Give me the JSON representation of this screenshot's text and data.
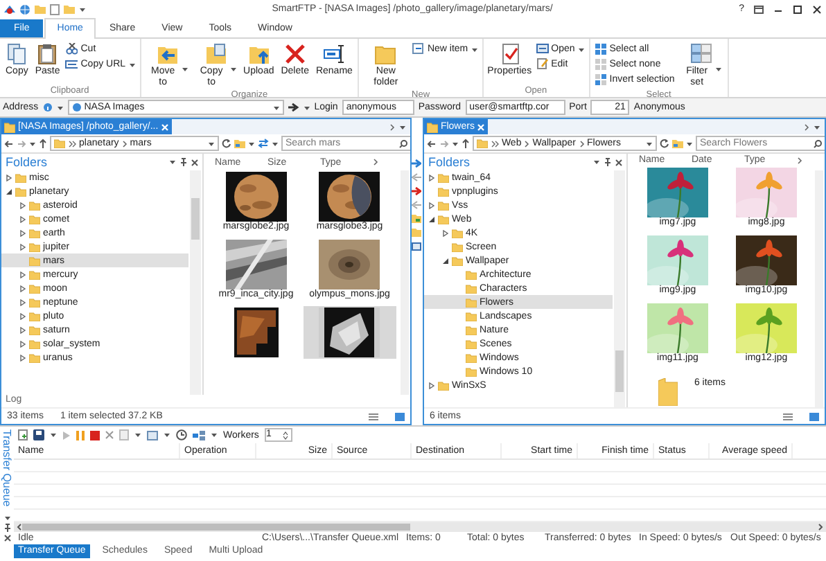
{
  "window": {
    "title": "SmartFTP - [NASA Images] /photo_gallery/image/planetary/mars/",
    "help": "?"
  },
  "ribbon_tabs": [
    {
      "label": "File",
      "kind": "file",
      "selected": false
    },
    {
      "label": "Home",
      "kind": "tab",
      "selected": true
    },
    {
      "label": "Share",
      "kind": "tab",
      "selected": false
    },
    {
      "label": "View",
      "kind": "tab",
      "selected": false
    },
    {
      "label": "Tools",
      "kind": "tab",
      "selected": false
    },
    {
      "label": "Window",
      "kind": "tab",
      "selected": false
    }
  ],
  "ribbon": {
    "groups": [
      {
        "label": "Clipboard",
        "items": [
          {
            "label": "Copy",
            "kind": "large"
          },
          {
            "label": "Paste",
            "kind": "large"
          },
          {
            "label": "Cut",
            "kind": "small"
          },
          {
            "label": "Copy URL",
            "kind": "small",
            "dropdown": true
          }
        ]
      },
      {
        "label": "Organize",
        "items": [
          {
            "label": "Move to",
            "kind": "large",
            "dropdown": true
          },
          {
            "label": "Copy to",
            "kind": "large",
            "dropdown": true
          },
          {
            "label": "Upload",
            "kind": "large"
          },
          {
            "label": "Delete",
            "kind": "large"
          },
          {
            "label": "Rename",
            "kind": "large"
          }
        ]
      },
      {
        "label": "New",
        "items": [
          {
            "label": "New folder",
            "kind": "large"
          },
          {
            "label": "New item",
            "kind": "small",
            "dropdown": true
          }
        ]
      },
      {
        "label": "Open",
        "items": [
          {
            "label": "Properties",
            "kind": "large"
          },
          {
            "label": "Open",
            "kind": "small",
            "dropdown": true
          },
          {
            "label": "Edit",
            "kind": "small"
          }
        ]
      },
      {
        "label": "Select",
        "items": [
          {
            "label": "Select all",
            "kind": "small"
          },
          {
            "label": "Select none",
            "kind": "small"
          },
          {
            "label": "Invert selection",
            "kind": "small"
          },
          {
            "label": "Filter set",
            "kind": "large",
            "dropdown": true
          }
        ]
      }
    ]
  },
  "address_bar": {
    "label": "Address",
    "value": "NASA Images",
    "fields": [
      {
        "label": "Login",
        "value": "anonymous"
      },
      {
        "label": "Password",
        "value": "user@smartftp.cor"
      },
      {
        "label": "Port",
        "value": "21"
      }
    ],
    "mode": "Anonymous"
  },
  "panes": [
    {
      "tab": "[NASA Images] /photo_gallery/...",
      "breadcrumb": [
        "planetary",
        "mars"
      ],
      "search": {
        "placeholder": "Search mars"
      },
      "tree_title": "Folders",
      "tree": [
        {
          "label": "misc",
          "expanded": false,
          "selected": false
        },
        {
          "label": "planetary",
          "expanded": true,
          "selected": false,
          "children": [
            {
              "label": "asteroid",
              "expanded": false,
              "selected": false
            },
            {
              "label": "comet",
              "expanded": false,
              "selected": false
            },
            {
              "label": "earth",
              "expanded": false,
              "selected": false
            },
            {
              "label": "jupiter",
              "expanded": false,
              "selected": false
            },
            {
              "label": "mars",
              "selected": true
            },
            {
              "label": "mercury",
              "expanded": false,
              "selected": false
            },
            {
              "label": "moon",
              "expanded": false,
              "selected": false
            },
            {
              "label": "neptune",
              "expanded": false,
              "selected": false
            },
            {
              "label": "pluto",
              "expanded": false,
              "selected": false
            },
            {
              "label": "saturn",
              "expanded": false,
              "selected": false
            },
            {
              "label": "solar_system",
              "expanded": false,
              "selected": false
            },
            {
              "label": "uranus",
              "expanded": false,
              "selected": false
            }
          ]
        }
      ],
      "columns": [
        "Name",
        "Size",
        "Type"
      ],
      "files": [
        {
          "kind": "picture",
          "name": "marsglobe2.jpg",
          "selected": false
        },
        {
          "kind": "picture",
          "name": "marsglobe3.jpg",
          "selected": false
        },
        {
          "kind": "picture",
          "name": "mr9_inca_city.jpg",
          "selected": false
        },
        {
          "kind": "picture",
          "name": "olympus_mons.jpg",
          "selected": false
        },
        {
          "kind": "picture",
          "selected": false
        },
        {
          "kind": "picture",
          "selected": true
        }
      ],
      "log": "Log",
      "status": [
        "33 items",
        "1 item selected  37.2 KB"
      ]
    },
    {
      "tab": "Flowers",
      "breadcrumb": [
        "Web",
        "Wallpaper",
        "Flowers"
      ],
      "search": {
        "placeholder": "Search Flowers"
      },
      "tree_title": "Folders",
      "tree": [
        {
          "label": "twain_64",
          "expanded": false,
          "selected": false
        },
        {
          "label": "vpnplugins",
          "selected": false
        },
        {
          "label": "Vss",
          "expanded": false,
          "selected": false
        },
        {
          "label": "Web",
          "expanded": true,
          "selected": false,
          "children": [
            {
              "label": "4K",
              "expanded": false,
              "selected": false
            },
            {
              "label": "Screen",
              "selected": false
            },
            {
              "label": "Wallpaper",
              "expanded": true,
              "selected": false,
              "children": [
                {
                  "label": "Architecture",
                  "selected": false
                },
                {
                  "label": "Characters",
                  "selected": false
                },
                {
                  "label": "Flowers",
                  "selected": true
                },
                {
                  "label": "Landscapes",
                  "selected": false
                },
                {
                  "label": "Nature",
                  "selected": false
                },
                {
                  "label": "Scenes",
                  "selected": false
                },
                {
                  "label": "Windows",
                  "selected": false
                },
                {
                  "label": "Windows 10",
                  "selected": false
                }
              ]
            }
          ]
        },
        {
          "label": "WinSxS",
          "expanded": false,
          "selected": false
        }
      ],
      "columns": [
        "Name",
        "Date",
        "Type"
      ],
      "files": [
        {
          "kind": "picture",
          "name": "img7.jpg",
          "selected": false
        },
        {
          "kind": "picture",
          "name": "img8.jpg",
          "selected": false
        },
        {
          "kind": "picture",
          "name": "img9.jpg",
          "selected": false
        },
        {
          "kind": "picture",
          "name": "img10.jpg",
          "selected": false
        },
        {
          "kind": "picture",
          "name": "img11.jpg",
          "selected": false
        },
        {
          "kind": "picture",
          "name": "img12.jpg",
          "selected": false
        },
        {
          "kind": "folder",
          "name": "6 items",
          "selected": false
        }
      ],
      "status": [
        "6 items"
      ]
    }
  ],
  "transfer_queue": {
    "title": "Transfer Queue",
    "workers_label": "Workers",
    "workers": "1",
    "columns": [
      "Name",
      "Operation",
      "Size",
      "Source",
      "Destination",
      "Start time",
      "Finish time",
      "Status",
      "Average speed"
    ],
    "status": [
      "Idle",
      "C:\\Users\\...\\Transfer Queue.xml",
      "Items: 0",
      "Total: 0 bytes",
      "Transferred: 0 bytes",
      "In Speed: 0 bytes/s",
      "Out Speed: 0 bytes/s"
    ]
  },
  "bottom_tabs": [
    {
      "label": "Transfer Queue",
      "selected": true
    },
    {
      "label": "Schedules",
      "selected": false
    },
    {
      "label": "Speed",
      "selected": false
    },
    {
      "label": "Multi Upload",
      "selected": false
    }
  ]
}
